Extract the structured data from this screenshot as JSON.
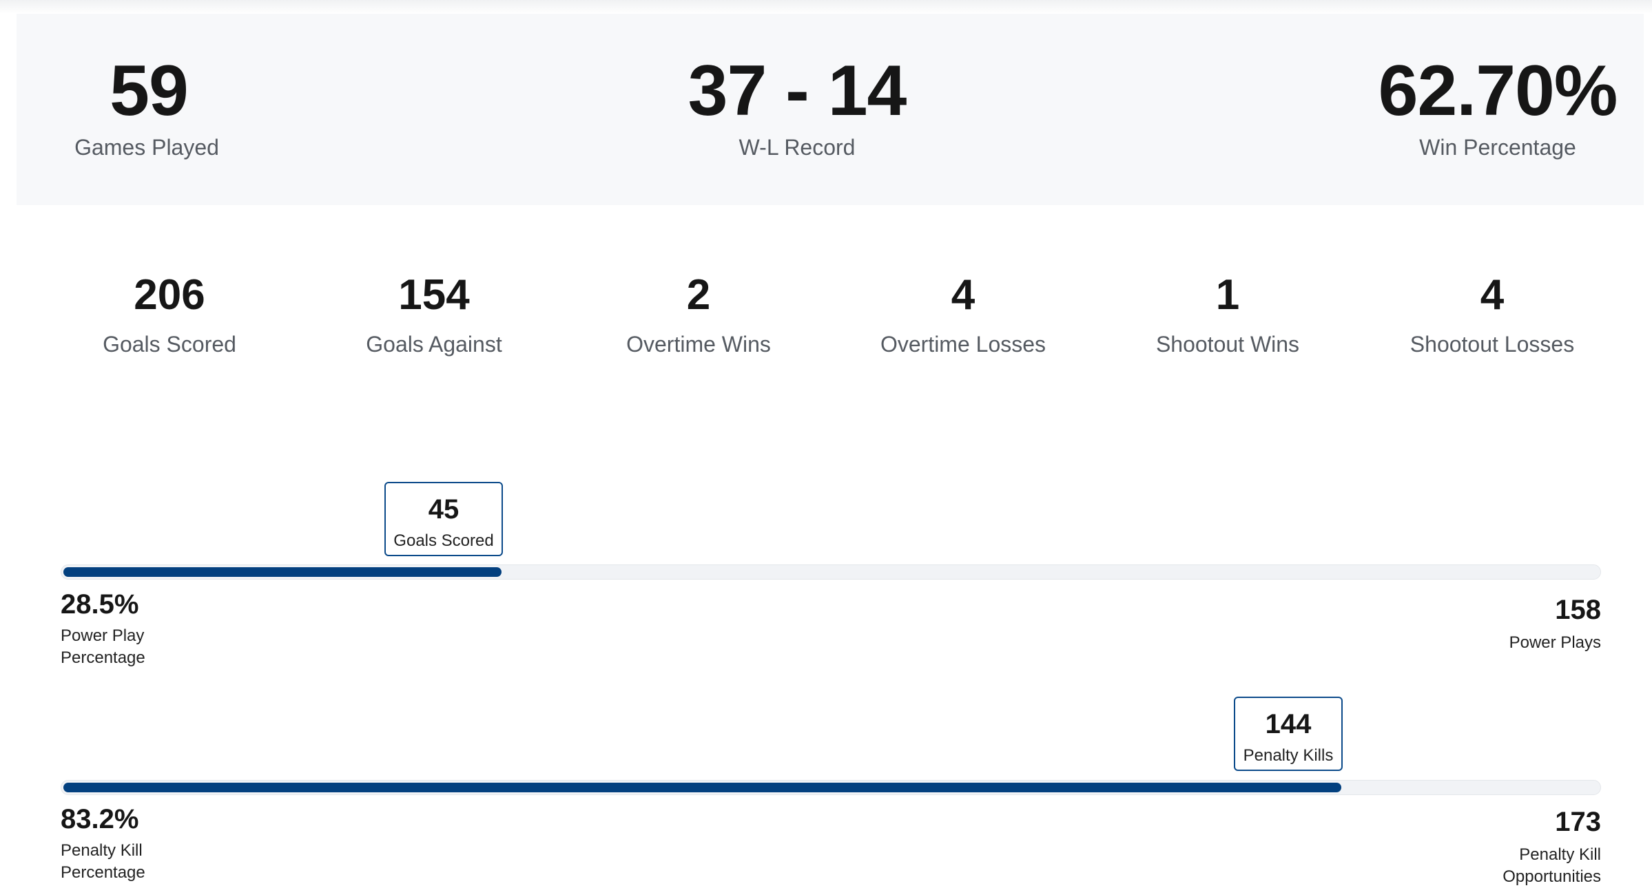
{
  "summary": {
    "games_played": {
      "value": "59",
      "label": "Games Played"
    },
    "record": {
      "value": "37 - 14",
      "label": "W-L Record"
    },
    "win_percentage": {
      "value": "62.70%",
      "label": "Win Percentage"
    }
  },
  "stats": [
    {
      "value": "206",
      "label": "Goals Scored"
    },
    {
      "value": "154",
      "label": "Goals Against"
    },
    {
      "value": "2",
      "label": "Overtime Wins"
    },
    {
      "value": "4",
      "label": "Overtime Losses"
    },
    {
      "value": "1",
      "label": "Shootout Wins"
    },
    {
      "value": "4",
      "label": "Shootout Losses"
    }
  ],
  "power_play": {
    "callout_value": "45",
    "callout_label": "Goals Scored",
    "percent_value": "28.5%",
    "percent_label_line1": "Power Play",
    "percent_label_line2": "Percentage",
    "total_value": "158",
    "total_label": "Power Plays",
    "fill_fraction": 0.285
  },
  "penalty_kill": {
    "callout_value": "144",
    "callout_label": "Penalty Kills",
    "percent_value": "83.2%",
    "percent_label_line1": "Penalty Kill",
    "percent_label_line2": "Percentage",
    "total_value": "173",
    "total_label_line1": "Penalty Kill",
    "total_label_line2": "Opportunities",
    "fill_fraction": 0.832
  },
  "colors": {
    "bar_fill": "#03407f",
    "bar_track": "#f1f3f6",
    "panel_bg": "#f7f8fa"
  }
}
